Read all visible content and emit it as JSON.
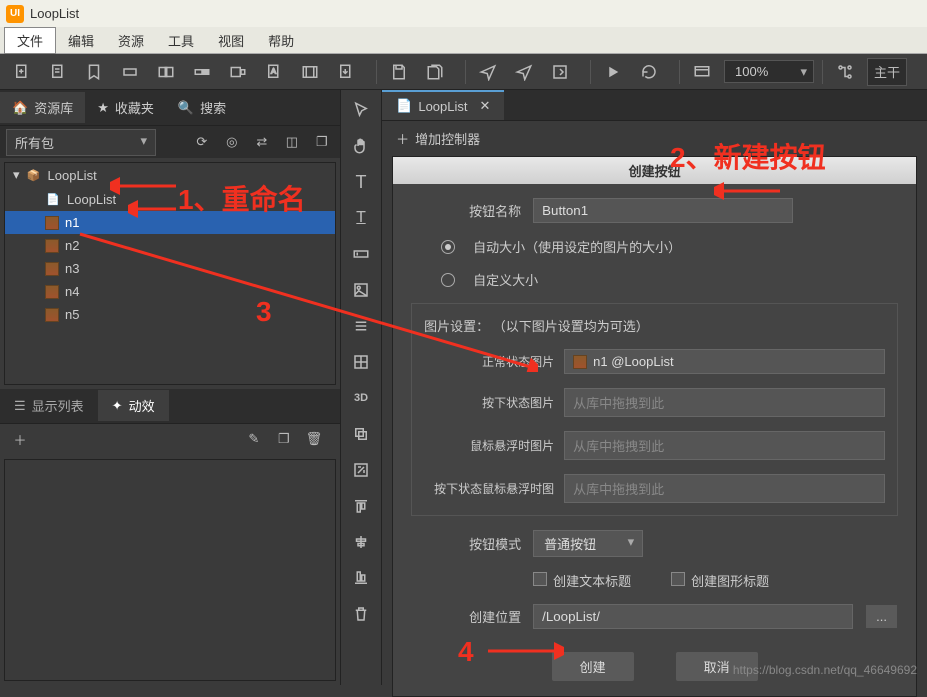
{
  "app": {
    "title": "LoopList",
    "logo_text": "UI"
  },
  "menu": {
    "file": "文件",
    "edit": "编辑",
    "resource": "资源",
    "tool": "工具",
    "view": "视图",
    "help": "帮助"
  },
  "toolbar": {
    "zoom": "100%",
    "main_label": "主干"
  },
  "lefttabs": {
    "library": "资源库",
    "favorites": "收藏夹",
    "search": "搜索"
  },
  "package_dropdown": "所有包",
  "tree": {
    "root": "LoopList",
    "doc": "LoopList",
    "items": [
      "n1",
      "n2",
      "n3",
      "n4",
      "n5"
    ]
  },
  "bottomtabs": {
    "list": "显示列表",
    "anim": "动效"
  },
  "doctab": "LoopList",
  "addctrl": "增加控制器",
  "dialog": {
    "title": "创建按钮",
    "name_label": "按钮名称",
    "name_value": "Button1",
    "radio_auto": "自动大小（使用设定的图片的大小）",
    "radio_custom": "自定义大小",
    "img_section": "图片设置：  （以下图片设置均为可选）",
    "img_normal": "正常状态图片",
    "img_normal_val": "n1 @LoopList",
    "img_down": "按下状态图片",
    "img_hover": "鼠标悬浮时图片",
    "img_downhover": "按下状态鼠标悬浮时图",
    "placeholder": "从库中拖拽到此",
    "mode_label": "按钮模式",
    "mode_value": "普通按钮",
    "chk_text": "创建文本标题",
    "chk_graphic": "创建图形标题",
    "pos_label": "创建位置",
    "pos_value": "/LoopList/",
    "create": "创建",
    "cancel": "取消",
    "browse": "..."
  },
  "annotations": {
    "a1": "1、重命名",
    "a2": "2、新建按钮",
    "a3": "3",
    "a4": "4"
  },
  "watermark": "https://blog.csdn.net/qq_46649692"
}
